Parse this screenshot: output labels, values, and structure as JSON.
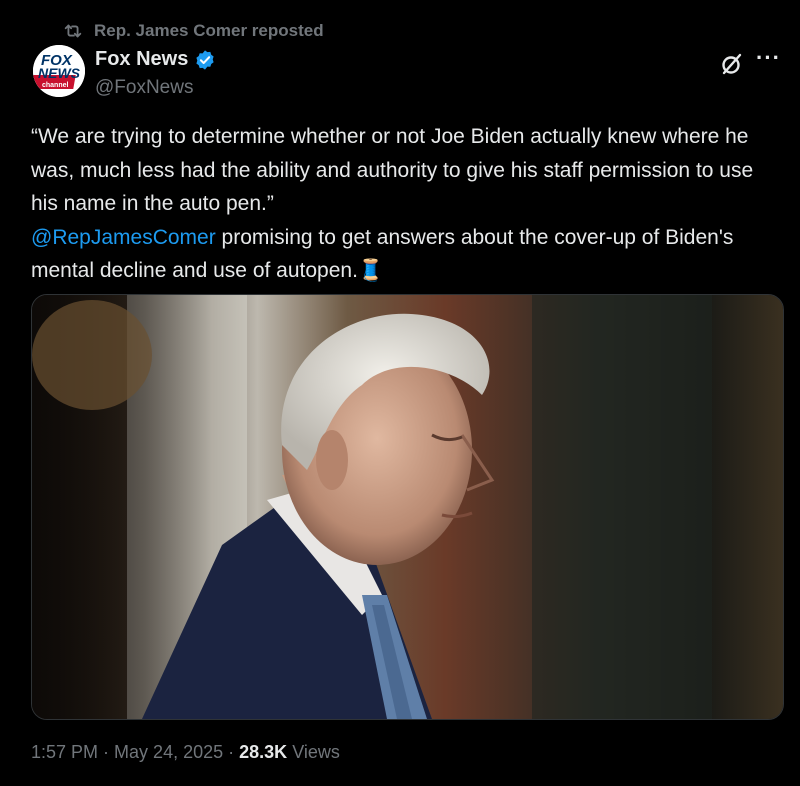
{
  "repost": {
    "label": "Rep. James Comer reposted"
  },
  "author": {
    "name": "Fox News",
    "handle": "@FoxNews",
    "avatar_text": {
      "line1": "FOX",
      "line2": "NEWS",
      "line3": "channel"
    }
  },
  "tweet": {
    "quote": "“We are trying to determine whether or not Joe Biden actually knew where he was, much less had the ability and authority to give his staff permission to use his name in the auto pen.”",
    "mention": "@RepJamesComer",
    "rest": " promising to get answers about the cover-up of Biden's mental decline and use of autopen.",
    "emoji": "🧵"
  },
  "meta": {
    "time": "1:57 PM",
    "date": "May 24, 2025",
    "views_count": "28.3K",
    "views_label": "Views",
    "sep": " · "
  },
  "icons": {
    "repost": "repost-icon",
    "verified": "verified-badge-icon",
    "grok": "grok-icon",
    "more": "more-icon"
  },
  "colors": {
    "background": "#000000",
    "text": "#e7e9ea",
    "muted": "#71767b",
    "link": "#1d9bf0",
    "verified": "#1d9bf0"
  }
}
